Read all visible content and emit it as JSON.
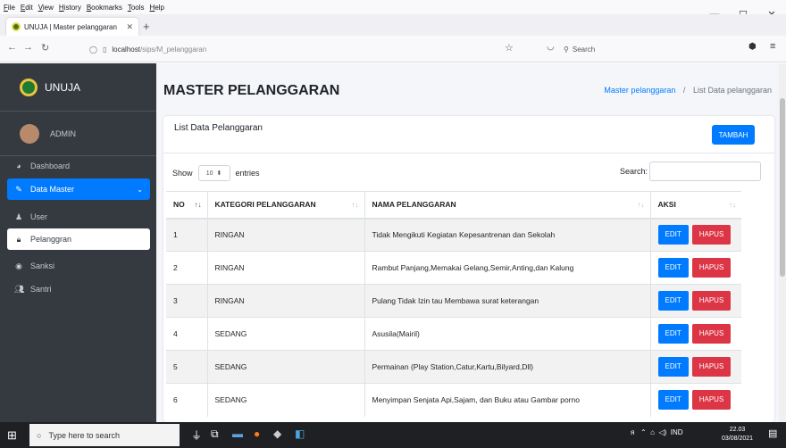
{
  "browser": {
    "menu": [
      "File",
      "Edit",
      "View",
      "History",
      "Bookmarks",
      "Tools",
      "Help"
    ],
    "tab_title": "UNUJA | Master pelanggaran",
    "url_host": "localhost",
    "url_path": "/sips/M_pelanggaran",
    "search_placeholder": "Search",
    "controls": {
      "minimize": "—",
      "maximize": "☐",
      "close": "✕"
    }
  },
  "sidebar": {
    "brand": "UNUJA",
    "user": "ADMIN",
    "items": [
      {
        "label": "Dashboard",
        "icon": "tachometer-icon"
      },
      {
        "label": "Data Master",
        "icon": "wrench-icon",
        "active": true
      },
      {
        "label": "User",
        "icon": "user-icon"
      },
      {
        "label": "Pelanggran",
        "icon": "lock-icon",
        "selected": true
      },
      {
        "label": "Sanksi",
        "icon": "eye-icon"
      },
      {
        "label": "Santri",
        "icon": "users-icon"
      }
    ]
  },
  "page": {
    "title": "MASTER PELANGGARAN",
    "breadcrumb_link": "Master pelanggaran",
    "breadcrumb_sep": "/",
    "breadcrumb_current": "List Data pelanggaran"
  },
  "card": {
    "title": "List Data Pelanggaran",
    "add_button": "TAMBAH",
    "show_label": "Show",
    "entries_value": "10",
    "entries_label": "entries",
    "search_label": "Search:"
  },
  "table": {
    "headers": [
      "NO",
      "KATEGORI PELANGGARAN",
      "NAMA PELANGGARAN",
      "AKSI"
    ],
    "edit_label": "EDIT",
    "delete_label": "HAPUS",
    "rows": [
      [
        "1",
        "RINGAN",
        "Tidak Mengikuti Kegiatan Kepesantrenan dan Sekolah"
      ],
      [
        "2",
        "RINGAN",
        "Rambut Panjang,Memakai Gelang,Semir,Anting,dan Kalung"
      ],
      [
        "3",
        "RINGAN",
        "Pulang Tidak Izin tau Membawa surat keterangan"
      ],
      [
        "4",
        "SEDANG",
        "Asusila(Mairil)"
      ],
      [
        "5",
        "SEDANG",
        "Permainan (Play Station,Catur,Kartu,Bilyard,Dll)"
      ],
      [
        "6",
        "SEDANG",
        "Menyimpan Senjata Api,Sajam, dan Buku atau Gambar porno"
      ]
    ]
  },
  "taskbar": {
    "search_placeholder": "Type here to search",
    "tray": "IND",
    "time": "22.03",
    "date": "03/08/2021"
  },
  "colors": {
    "primary": "#007bff",
    "danger": "#dc3545",
    "sidebar": "#343a40"
  }
}
